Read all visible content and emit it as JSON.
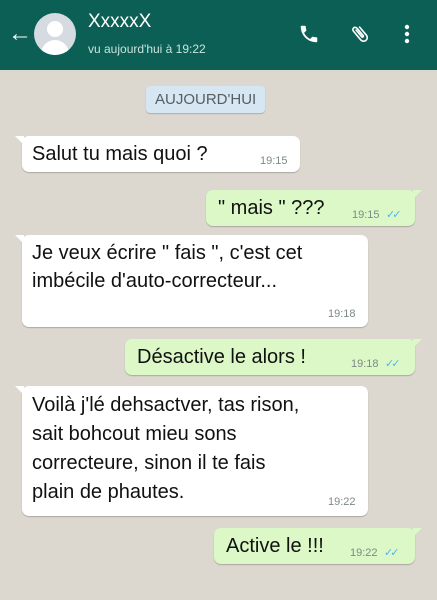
{
  "header": {
    "back_icon": "arrow-left-icon",
    "contact_name": "XxxxxX",
    "last_seen": "vu aujourd'hui à 19:22",
    "call_icon": "phone-icon",
    "attach_icon": "paperclip-icon",
    "menu_icon": "more-vert-icon"
  },
  "chat": {
    "date_chip": "AUJOURD'HUI",
    "messages": [
      {
        "direction": "in",
        "lines": [
          "Salut tu mais quoi ?"
        ],
        "time": "19:15"
      },
      {
        "direction": "out",
        "lines": [
          "\" mais \" ???"
        ],
        "time": "19:15",
        "read": true
      },
      {
        "direction": "in",
        "lines": [
          "Je veux écrire \" fais \", c'est cet",
          "imbécile d'auto-correcteur..."
        ],
        "time": "19:18"
      },
      {
        "direction": "out",
        "lines": [
          "Désactive le alors !"
        ],
        "time": "19:18",
        "read": true
      },
      {
        "direction": "in",
        "lines": [
          "Voilà j'lé dehsactver, tas rison,",
          "sait bohcout mieu sons",
          "correcteure, sinon il te fais",
          "plain de phautes."
        ],
        "time": "19:22"
      },
      {
        "direction": "out",
        "lines": [
          "Active le !!!"
        ],
        "time": "19:22",
        "read": true
      }
    ]
  },
  "colors": {
    "header": "#0c5f55",
    "outgoing": "#dcf8c6",
    "incoming": "#ffffff",
    "ticks": "#4fb6ec"
  }
}
